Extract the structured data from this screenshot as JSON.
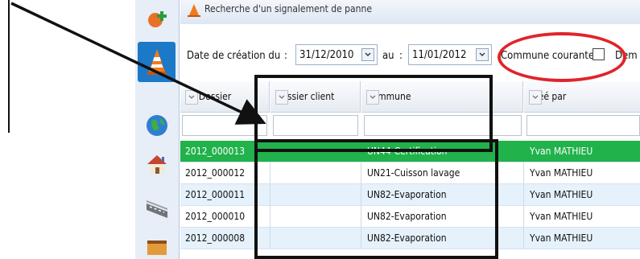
{
  "window": {
    "title": "Recherche d'un signalement de panne"
  },
  "sidebar": {
    "items": [
      {
        "icon": "add-icon"
      },
      {
        "icon": "traffic-cone-icon",
        "active": true
      },
      {
        "icon": "globe-icon"
      },
      {
        "icon": "house-icon"
      },
      {
        "icon": "road-icon"
      },
      {
        "icon": "map-icon"
      }
    ]
  },
  "filters": {
    "date_label": "Date de création du",
    "colon": ":",
    "from_date": "31/12/2010",
    "to_label": "au",
    "to_date": "11/01/2012",
    "commune_courante_label": "Commune courante",
    "commune_courante_checked": false,
    "demand_label": "Dem"
  },
  "grid": {
    "columns": [
      {
        "label": "N° Dossier"
      },
      {
        "label": "Dossier client"
      },
      {
        "label": "Commune"
      },
      {
        "label": "Créé par"
      }
    ],
    "rows": [
      {
        "dossier": "2012_000013",
        "dossier_client": "",
        "commune": "UN44-Certification",
        "cree_par": "Yvan MATHIEU",
        "selected": true
      },
      {
        "dossier": "2012_000012",
        "dossier_client": "",
        "commune": "UN21-Cuisson lavage",
        "cree_par": "Yvan MATHIEU"
      },
      {
        "dossier": "2012_000011",
        "dossier_client": "",
        "commune": "UN82-Evaporation",
        "cree_par": "Yvan MATHIEU"
      },
      {
        "dossier": "2012_000010",
        "dossier_client": "",
        "commune": "UN82-Evaporation",
        "cree_par": "Yvan MATHIEU"
      },
      {
        "dossier": "2012_000008",
        "dossier_client": "",
        "commune": "UN82-Evaporation",
        "cree_par": "Yvan MATHIEU"
      }
    ]
  },
  "colors": {
    "selected_row": "#21b24b",
    "alt_row": "#e5f1fb",
    "annotation_ellipse": "#e0242a",
    "annotation_box": "#111111"
  }
}
